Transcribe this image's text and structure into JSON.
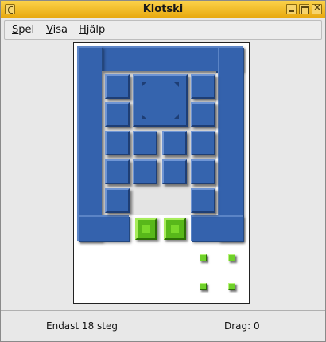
{
  "window": {
    "title": "Klotski"
  },
  "menu": {
    "items": [
      {
        "accel": "S",
        "rest": "pel"
      },
      {
        "accel": "V",
        "rest": "isa"
      },
      {
        "accel": "H",
        "rest": "jälp"
      }
    ]
  },
  "game": {
    "pieces": [
      {
        "kind": "small",
        "name": "piece-small"
      },
      {
        "kind": "big",
        "name": "piece-big"
      }
    ],
    "exit_gate_count": 2,
    "target_marker_count": 4,
    "colors": {
      "piece": "#3564ae",
      "gate": "#58b81a",
      "board": "#ffffff"
    }
  },
  "status": {
    "message": "Endast 18 steg",
    "moves_label": "Drag:",
    "moves": "0"
  }
}
